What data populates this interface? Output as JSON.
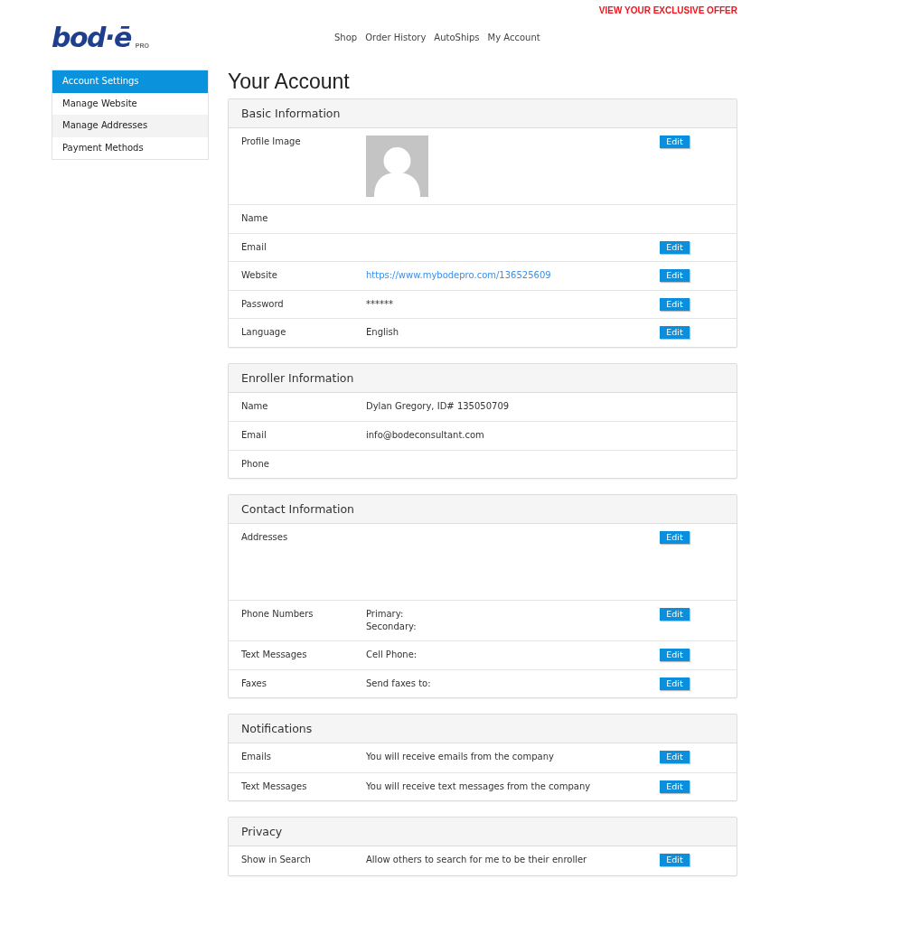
{
  "header": {
    "offer": "VIEW YOUR EXCLUSIVE OFFER",
    "logo": {
      "wordmark": "bod·ē",
      "tagline": "PRO"
    },
    "nav": [
      "Shop",
      "Order History",
      "AutoShips",
      "My Account"
    ]
  },
  "sidebar": {
    "items": [
      {
        "label": "Account Settings",
        "selected": true,
        "hovered": false
      },
      {
        "label": "Manage Website",
        "selected": false,
        "hovered": false
      },
      {
        "label": "Manage Addresses",
        "selected": false,
        "hovered": true
      },
      {
        "label": "Payment Methods",
        "selected": false,
        "hovered": false
      }
    ]
  },
  "page_title": "Your Account",
  "sections": [
    {
      "title": "Basic Information",
      "rows": [
        {
          "label": "Profile Image",
          "kind": "image",
          "button": "Edit"
        },
        {
          "label": "Name",
          "kind": "text"
        },
        {
          "label": "Email",
          "kind": "text",
          "button": "Edit"
        },
        {
          "label": "Website",
          "kind": "link",
          "value": "https://www.mybodepro.com/136525609",
          "button": "Edit"
        },
        {
          "label": "Password",
          "kind": "text",
          "value": "******",
          "button": "Edit"
        },
        {
          "label": "Language",
          "kind": "text",
          "value": "English",
          "button": "Edit"
        }
      ]
    },
    {
      "title": "Enroller Information",
      "rows": [
        {
          "label": "Name",
          "kind": "text",
          "value": "Dylan Gregory, ID# 135050709"
        },
        {
          "label": "Email",
          "kind": "text",
          "value": "info@bodeconsultant.com"
        },
        {
          "label": "Phone",
          "kind": "text"
        }
      ]
    },
    {
      "title": "Contact Information",
      "rows": [
        {
          "label": "Addresses",
          "kind": "block",
          "button": "Edit"
        },
        {
          "label": "Phone Numbers",
          "kind": "lines",
          "values": [
            "Primary:",
            "Secondary:"
          ],
          "button": "Edit"
        },
        {
          "label": "Text Messages",
          "kind": "text",
          "value": "Cell Phone:",
          "button": "Edit"
        },
        {
          "label": "Faxes",
          "kind": "text",
          "value": "Send faxes to:",
          "button": "Edit"
        }
      ]
    },
    {
      "title": "Notifications",
      "rows": [
        {
          "label": "Emails",
          "kind": "text",
          "value": "You will receive emails from the company",
          "button": "Edit"
        },
        {
          "label": "Text Messages",
          "kind": "text",
          "value": "You will receive text messages from the company",
          "button": "Edit"
        }
      ]
    },
    {
      "title": "Privacy",
      "rows": [
        {
          "label": "Show in Search",
          "kind": "text",
          "value": "Allow others to search for me to be their enroller",
          "button": "Edit"
        }
      ]
    }
  ]
}
